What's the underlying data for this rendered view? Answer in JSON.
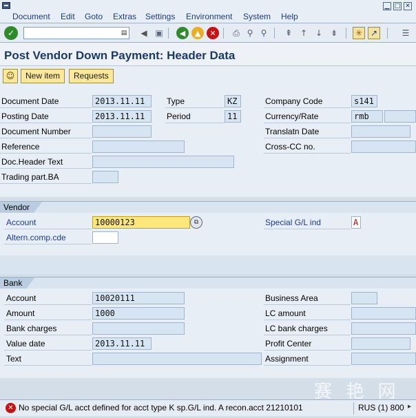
{
  "menu": {
    "items": [
      "Document",
      "Edit",
      "Goto",
      "Extras",
      "Settings",
      "Environment",
      "System",
      "Help"
    ]
  },
  "toolbar": {
    "command_value": ""
  },
  "title": "Post Vendor Down Payment: Header Data",
  "app_toolbar": {
    "new_item": "New item",
    "requests": "Requests"
  },
  "header": {
    "document_date_label": "Document Date",
    "document_date": "2013.11.11",
    "type_label": "Type",
    "type": "KZ",
    "company_code_label": "Company Code",
    "company_code": "s141",
    "posting_date_label": "Posting Date",
    "posting_date": "2013.11.11",
    "period_label": "Period",
    "period": "11",
    "currency_label": "Currency/Rate",
    "currency": "rmb",
    "rate": "",
    "document_number_label": "Document Number",
    "document_number": "",
    "translatn_date_label": "Translatn Date",
    "translatn_date": "",
    "reference_label": "Reference",
    "reference": "",
    "cross_cc_label": "Cross-CC no.",
    "cross_cc": "",
    "doc_header_text_label": "Doc.Header Text",
    "doc_header_text": "",
    "trading_part_label": "Trading part.BA",
    "trading_part": ""
  },
  "vendor": {
    "group_label": "Vendor",
    "account_label": "Account",
    "account": "10000123",
    "altern_label": "Altern.comp.cde",
    "altern": "",
    "special_gl_label": "Special G/L ind",
    "special_gl": "A"
  },
  "bank": {
    "group_label": "Bank",
    "account_label": "Account",
    "account": "10020111",
    "amount_label": "Amount",
    "amount": "1000",
    "bank_charges_label": "Bank charges",
    "bank_charges": "",
    "value_date_label": "Value date",
    "value_date": "2013.11.11",
    "text_label": "Text",
    "text": "",
    "business_area_label": "Business Area",
    "business_area": "",
    "lc_amount_label": "LC amount",
    "lc_amount": "",
    "lc_bank_charges_label": "LC bank charges",
    "lc_bank_charges": "",
    "profit_center_label": "Profit Center",
    "profit_center": "",
    "assignment_label": "Assignment",
    "assignment": ""
  },
  "status": {
    "message": "No special G/L acct defined for acct type K sp.G/L ind. A recon.acct 21210101",
    "system": "RUS (1) 800"
  },
  "watermark": "赛 艳 网",
  "colors": {
    "title": "#1a3a6a",
    "label_link": "#1a3aa8",
    "highlight_field": "#ffe77a",
    "error": "#cc1010"
  }
}
